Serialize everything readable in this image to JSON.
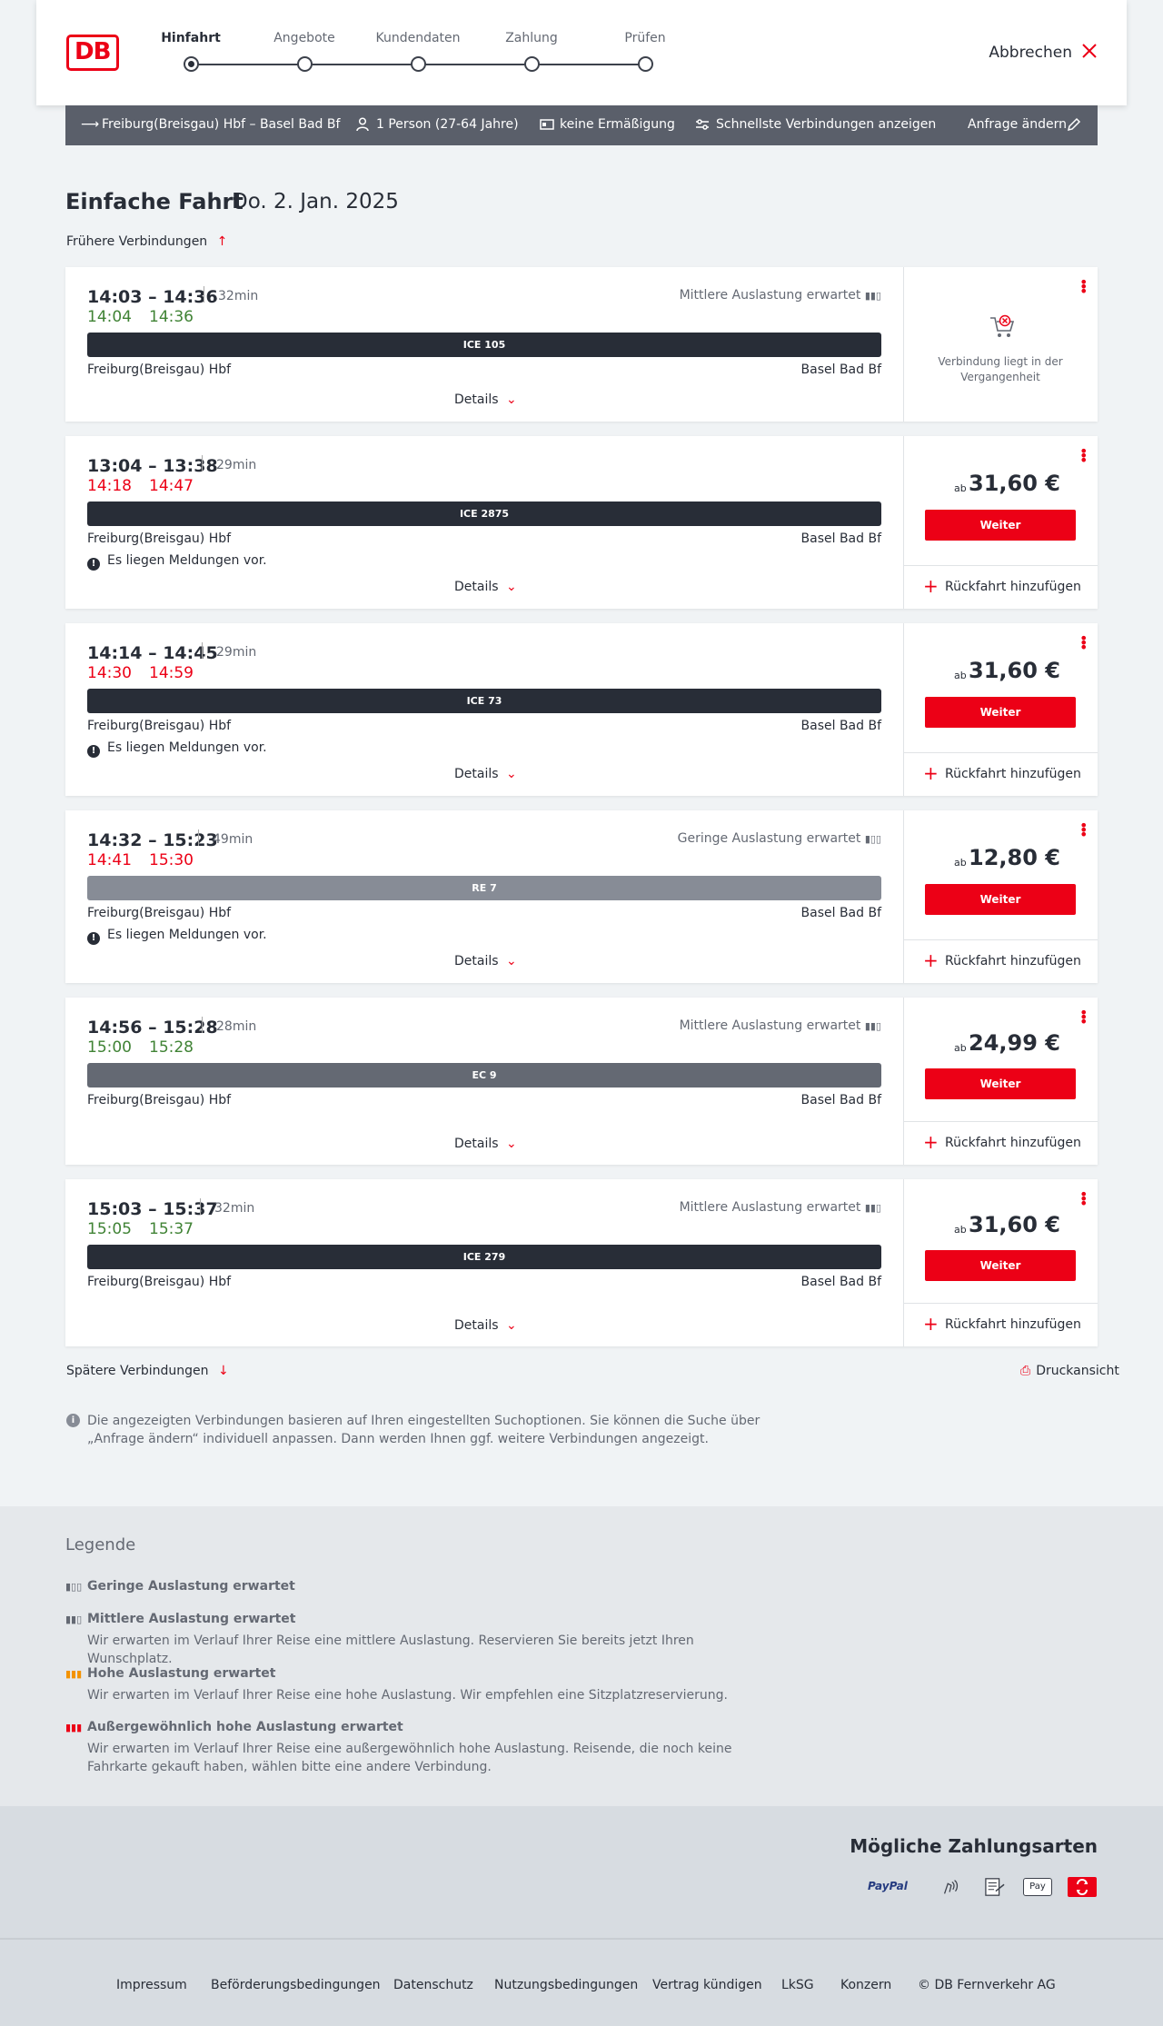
{
  "header": {
    "logo": "DB",
    "steps": [
      {
        "label": "Hinfahrt",
        "active": true
      },
      {
        "label": "Angebote",
        "active": false
      },
      {
        "label": "Kundendaten",
        "active": false
      },
      {
        "label": "Zahlung",
        "active": false
      },
      {
        "label": "Prüfen",
        "active": false
      }
    ],
    "cancel_label": "Abbrechen"
  },
  "search": {
    "route": "Freiburg(Breisgau) Hbf – Basel Bad Bf",
    "persons": "1 Person (27-64 Jahre)",
    "discount": "keine Ermäßigung",
    "option": "Schnellste Verbindungen anzeigen",
    "change_label": "Anfrage ändern"
  },
  "page": {
    "title": "Einfache Fahrt",
    "date": "Do. 2. Jan. 2025",
    "earlier_label": "Frühere Verbindungen",
    "later_label": "Spätere Verbindungen",
    "print_label": "Druckansicht",
    "info_text": "Die angezeigten Verbindungen basieren auf Ihren eingestellten Suchoptionen. Sie können die Suche über „Anfrage ändern“ individuell anpassen. Dann werden Ihnen ggf. weitere Verbindungen angezeigt."
  },
  "common": {
    "details_label": "Details",
    "weiter_label": "Weiter",
    "return_label": "Rückfahrt hinzufügen",
    "price_prefix": "ab",
    "message_label": "Es liegen Meldungen vor.",
    "past_label": "Verbindung liegt in der Vergangenheit",
    "accent_color": "#ec0016"
  },
  "connections": [
    {
      "times": "14:03 – 14:36",
      "duration": "32min",
      "rt_dep": "14:04",
      "rt_arr": "14:36",
      "rt_status": "ok",
      "train": "ICE 105",
      "train_color": "#282d37",
      "from": "Freiburg(Breisgau) Hbf",
      "to": "Basel Bad Bf",
      "load": "Mittlere Auslastung erwartet",
      "message": false,
      "price": null,
      "past": true
    },
    {
      "times": "13:04 – 13:38",
      "duration": "29min",
      "rt_dep": "14:18",
      "rt_arr": "14:47",
      "rt_status": "late",
      "train": "ICE 2875",
      "train_color": "#282d37",
      "from": "Freiburg(Breisgau) Hbf",
      "to": "Basel Bad Bf",
      "load": "",
      "message": true,
      "price": "31,60 €",
      "past": false
    },
    {
      "times": "14:14 – 14:45",
      "duration": "29min",
      "rt_dep": "14:30",
      "rt_arr": "14:59",
      "rt_status": "late",
      "train": "ICE 73",
      "train_color": "#282d37",
      "from": "Freiburg(Breisgau) Hbf",
      "to": "Basel Bad Bf",
      "load": "",
      "message": true,
      "price": "31,60 €",
      "past": false
    },
    {
      "times": "14:32 – 15:23",
      "duration": "49min",
      "rt_dep": "14:41",
      "rt_arr": "15:30",
      "rt_status": "late",
      "train": "RE 7",
      "train_color": "#878c96",
      "from": "Freiburg(Breisgau) Hbf",
      "to": "Basel Bad Bf",
      "load": "Geringe Auslastung erwartet",
      "message": true,
      "price": "12,80 €",
      "past": false
    },
    {
      "times": "14:56 – 15:28",
      "duration": "28min",
      "rt_dep": "15:00",
      "rt_arr": "15:28",
      "rt_status": "ok",
      "train": "EC 9",
      "train_color": "#646973",
      "from": "Freiburg(Breisgau) Hbf",
      "to": "Basel Bad Bf",
      "load": "Mittlere Auslastung erwartet",
      "message": false,
      "price": "24,99 €",
      "past": false
    },
    {
      "times": "15:03 – 15:37",
      "duration": "32min",
      "rt_dep": "15:05",
      "rt_arr": "15:37",
      "rt_status": "ok",
      "train": "ICE 279",
      "train_color": "#282d37",
      "from": "Freiburg(Breisgau) Hbf",
      "to": "Basel Bad Bf",
      "load": "Mittlere Auslastung erwartet",
      "message": false,
      "price": "31,60 €",
      "past": false
    }
  ],
  "legend": {
    "title": "Legende",
    "items": [
      {
        "title": "Geringe Auslastung erwartet",
        "text": "",
        "icon": "load-low-icon"
      },
      {
        "title": "Mittlere Auslastung erwartet",
        "text": "Wir erwarten im Verlauf Ihrer Reise eine mittlere Auslastung. Reservieren Sie bereits jetzt Ihren Wunschplatz.",
        "icon": "load-medium-icon"
      },
      {
        "title": "Hohe Auslastung erwartet",
        "text": "Wir erwarten im Verlauf Ihrer Reise eine hohe Auslastung. Wir empfehlen eine Sitzplatzreservierung.",
        "icon": "load-high-icon"
      },
      {
        "title": "Außergewöhnlich hohe Auslastung erwartet",
        "text": "Wir erwarten im Verlauf Ihrer Reise eine außergewöhnlich hohe Auslastung. Reisende, die noch keine Fahrkarte gekauft haben, wählen bitte eine andere Verbindung.",
        "icon": "load-extreme-icon"
      }
    ]
  },
  "payments": {
    "title": "Mögliche Zahlungsarten",
    "paypal": "PayPal",
    "applepay": "Pay"
  },
  "footer": {
    "links": [
      "Impressum",
      "Beförderungsbedingungen",
      "Datenschutz",
      "Nutzungsbedingungen",
      "Vertrag kündigen",
      "LkSG",
      "Konzern",
      "© DB Fernverkehr AG"
    ]
  }
}
